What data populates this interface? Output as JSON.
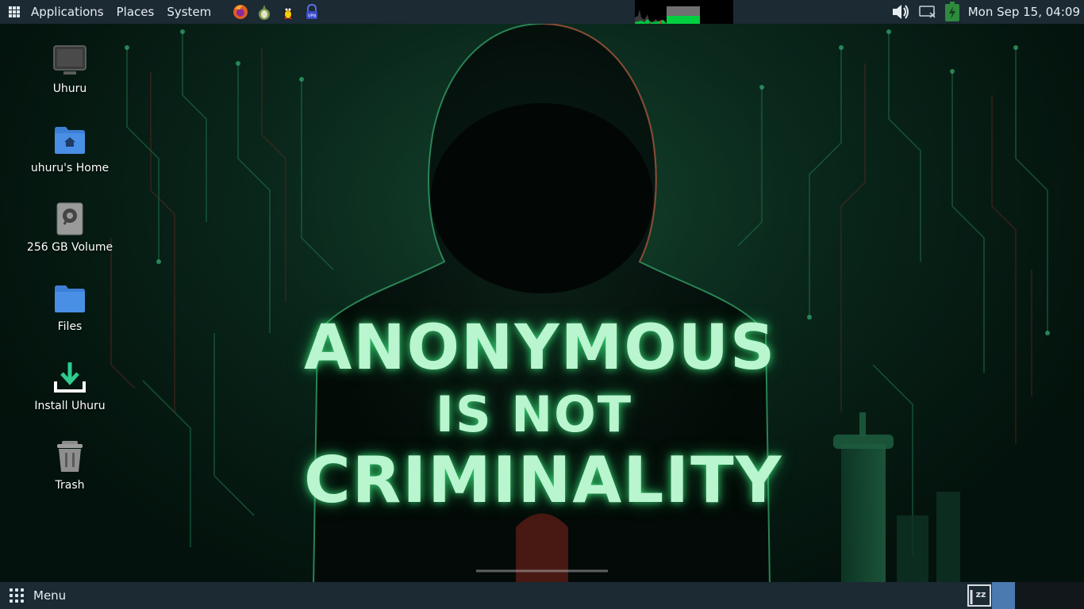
{
  "top_panel": {
    "menus": [
      "Applications",
      "Places",
      "System"
    ],
    "launchers": [
      "firefox-icon",
      "tor-browser-icon",
      "penguin-icon",
      "vpn-lock-icon"
    ],
    "clock": "Mon Sep 15, 04:09"
  },
  "desktop": {
    "icons": [
      {
        "label": "Uhuru",
        "icon": "computer-icon"
      },
      {
        "label": "uhuru's Home",
        "icon": "home-folder-icon"
      },
      {
        "label": "256 GB Volume",
        "icon": "drive-icon"
      },
      {
        "label": "Files",
        "icon": "folder-icon"
      },
      {
        "label": "Install Uhuru",
        "icon": "install-icon"
      },
      {
        "label": "Trash",
        "icon": "trash-icon"
      }
    ]
  },
  "wallpaper": {
    "line1": "ANONYMOUS",
    "line2": "IS NOT",
    "line3": "CRIMINALITY"
  },
  "bottom_panel": {
    "menu_label": "Menu"
  },
  "colors": {
    "panel": "#1b2a33",
    "headline": "#b9f5cf",
    "folder": "#3d7fd6",
    "install": "#2ecc8f"
  }
}
